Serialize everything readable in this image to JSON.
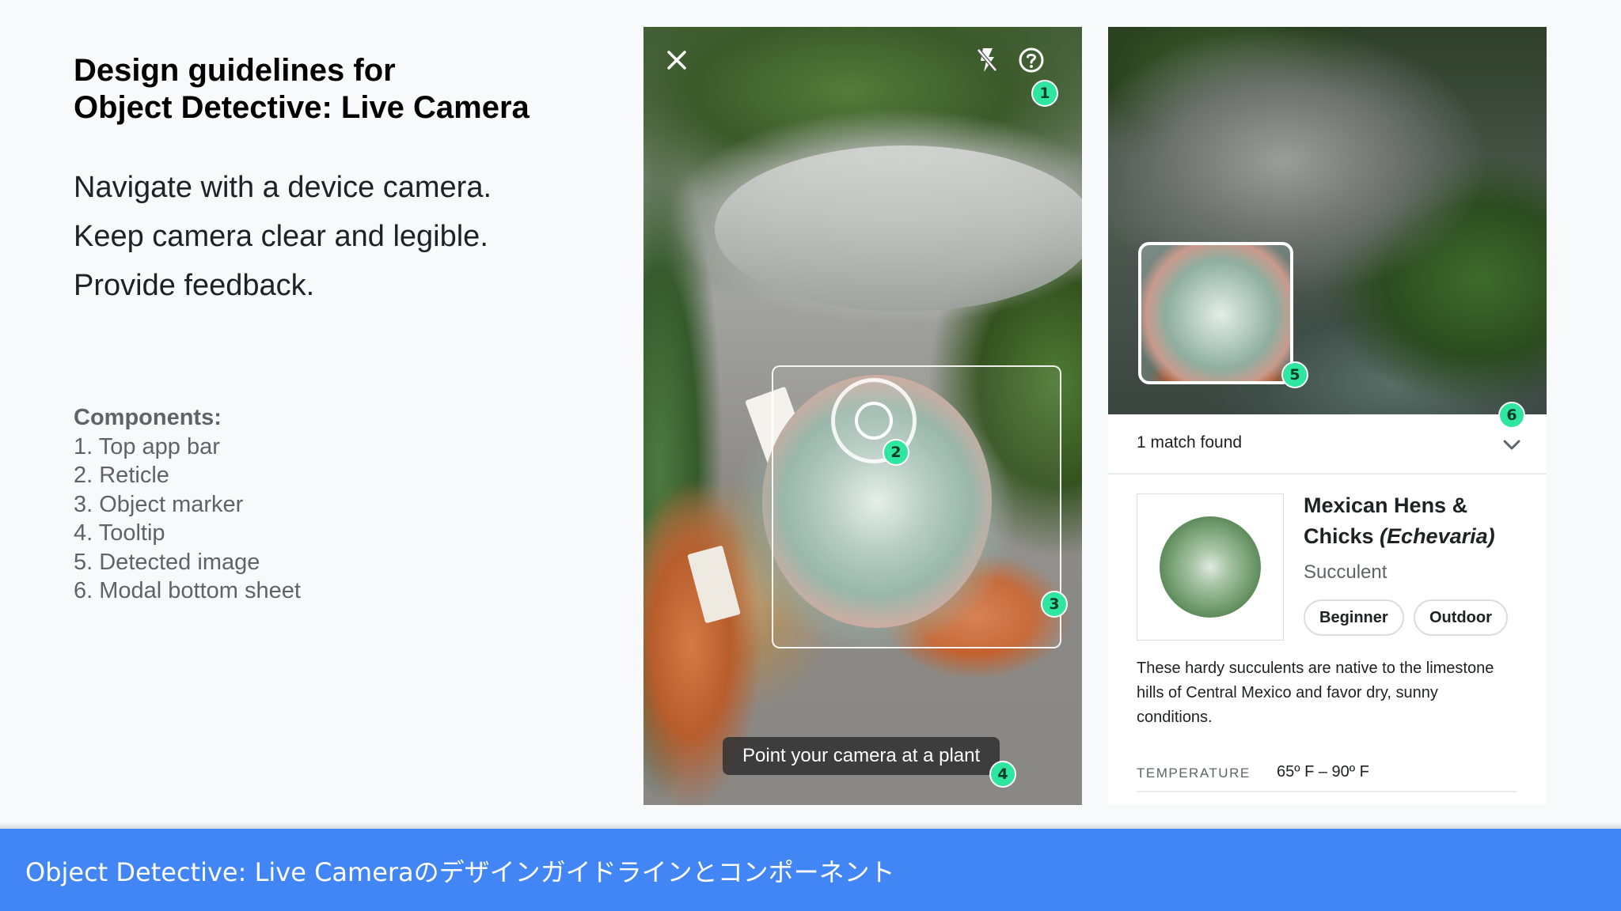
{
  "slide": {
    "title_line1": "Design guidelines for",
    "title_line2": "Object Detective: Live Camera",
    "guidelines": [
      "Navigate with a device camera.",
      "Keep camera clear and legible.",
      "Provide feedback."
    ],
    "components_heading": "Components:",
    "components": [
      "1. Top app bar",
      "2. Reticle",
      "3. Object marker",
      "4. Tooltip",
      "5. Detected image",
      "6. Modal bottom sheet"
    ]
  },
  "camera_screen": {
    "icons": [
      "close-icon",
      "flash-off-icon",
      "help-icon"
    ],
    "tooltip": "Point your camera at a plant",
    "badges": [
      "1",
      "2",
      "3",
      "4"
    ]
  },
  "result_screen": {
    "badges": [
      "5",
      "6"
    ],
    "sheet_header": "1 match found",
    "plant_name_line1": "Mexican Hens &",
    "plant_name_common": "Chicks ",
    "plant_name_scientific": "(Echevaria)",
    "plant_type": "Succulent",
    "chips": [
      "Beginner",
      "Outdoor"
    ],
    "description": "These hardy succulents are native to the limestone hills of Central Mexico and favor dry, sunny conditions.",
    "temperature_label": "TEMPERATURE",
    "temperature_value": "65º F – 90º F"
  },
  "footer": {
    "text": "Object Detective: Live Cameraのデザインガイドラインとコンポーネント"
  },
  "colors": {
    "footer_bg": "#4285f4",
    "badge": "#2ee6a0",
    "background": "#f8f9fa"
  }
}
